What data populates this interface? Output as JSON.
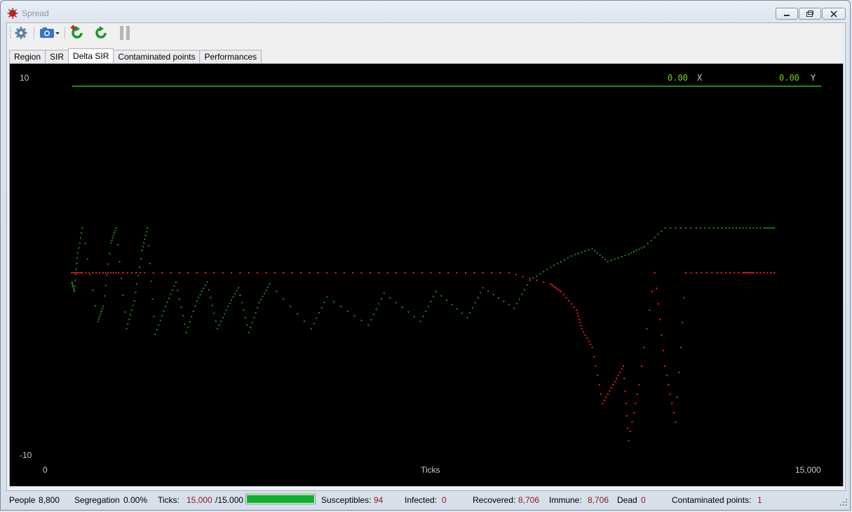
{
  "window": {
    "title": "Spread"
  },
  "toolbar": {
    "icons": [
      "gear-icon",
      "camera-icon",
      "restart-icon",
      "refresh-icon",
      "pause-icon"
    ]
  },
  "tabs": [
    {
      "label": "Region",
      "active": false
    },
    {
      "label": "SIR",
      "active": false
    },
    {
      "label": "Delta SIR",
      "active": true
    },
    {
      "label": "Contaminated points",
      "active": false
    },
    {
      "label": "Performances",
      "active": false
    }
  ],
  "plot": {
    "cursor_x_value": "0.00",
    "cursor_x_label": "X",
    "cursor_y_value": "0.00",
    "cursor_y_label": "Y",
    "colors": {
      "background": "#000000",
      "recovered": "#1f8a1f",
      "infected": "#ff1a1a",
      "readout": "#6fd400",
      "axis_text": "#c8c8c8"
    }
  },
  "chart_data": {
    "type": "scatter",
    "title": "",
    "xlabel": "Ticks",
    "ylabel": "",
    "xlim": [
      0,
      15000
    ],
    "ylim": [
      -10,
      10
    ],
    "x_tick_labels": [
      "0",
      "15,000"
    ],
    "y_tick_labels": [
      "10",
      "-10"
    ],
    "grid": false,
    "series": [
      {
        "color": "#1f8a1f",
        "description_points": "oscillating dips of green points between roughly -0.5 and -3 from ~600 to ~10,000 ticks, scattered points up to +2.4 after 10,000"
      },
      {
        "color": "#ff1a1a",
        "description_points": "red points near 0 across the run, dipping to about -9 between ~10,300 and ~11,600 ticks"
      }
    ],
    "top_line": {
      "y": 10,
      "x_start": 600,
      "x_end": 15000
    },
    "sampled_points": {
      "green": [
        [
          600,
          -0.5
        ],
        [
          650,
          -1
        ],
        [
          700,
          0.8
        ],
        [
          800,
          2.4
        ],
        [
          1100,
          -2.6
        ],
        [
          1200,
          -1.8
        ],
        [
          1350,
          1.6
        ],
        [
          1450,
          2.4
        ],
        [
          1650,
          -3.0
        ],
        [
          1800,
          -1.5
        ],
        [
          1950,
          1.2
        ],
        [
          2050,
          2.4
        ],
        [
          2200,
          -3.3
        ],
        [
          2400,
          -1.8
        ],
        [
          2600,
          -0.5
        ],
        [
          2800,
          -3.2
        ],
        [
          3000,
          -1.5
        ],
        [
          3200,
          -0.5
        ],
        [
          3400,
          -3.0
        ],
        [
          3600,
          -1.8
        ],
        [
          3800,
          -0.8
        ],
        [
          4000,
          -3.2
        ],
        [
          4200,
          -1.6
        ],
        [
          4400,
          -0.6
        ],
        [
          5200,
          -3.0
        ],
        [
          5500,
          -1.3
        ],
        [
          6300,
          -2.8
        ],
        [
          6600,
          -1.1
        ],
        [
          7300,
          -2.6
        ],
        [
          7600,
          -1.0
        ],
        [
          8200,
          -2.4
        ],
        [
          8500,
          -0.8
        ],
        [
          9100,
          -1.9
        ],
        [
          9400,
          -0.4
        ],
        [
          9800,
          0.3
        ],
        [
          10200,
          0.9
        ],
        [
          10600,
          1.3
        ],
        [
          10900,
          0.6
        ],
        [
          11300,
          1.0
        ],
        [
          11600,
          1.4
        ],
        [
          12000,
          2.4
        ],
        [
          12600,
          2.4
        ],
        [
          13100,
          2.4
        ],
        [
          13500,
          2.4
        ],
        [
          13900,
          2.4
        ],
        [
          14100,
          2.4
        ]
      ],
      "red": [
        [
          600,
          0
        ],
        [
          800,
          0
        ],
        [
          1200,
          0
        ],
        [
          1500,
          0
        ],
        [
          2000,
          0
        ],
        [
          3000,
          0
        ],
        [
          4000,
          0
        ],
        [
          5000,
          0
        ],
        [
          6000,
          0
        ],
        [
          7000,
          0
        ],
        [
          8000,
          0
        ],
        [
          9000,
          0
        ],
        [
          9800,
          -0.6
        ],
        [
          10000,
          -1
        ],
        [
          10300,
          -2
        ],
        [
          10400,
          -3
        ],
        [
          10600,
          -4
        ],
        [
          10800,
          -7
        ],
        [
          11000,
          -6
        ],
        [
          11200,
          -5
        ],
        [
          11300,
          -9
        ],
        [
          11500,
          -6
        ],
        [
          11800,
          0
        ],
        [
          12000,
          -5
        ],
        [
          12200,
          -8
        ],
        [
          12400,
          0
        ],
        [
          13000,
          0
        ],
        [
          13500,
          0
        ],
        [
          13700,
          0
        ],
        [
          14100,
          0
        ]
      ]
    }
  },
  "status": {
    "people_label": "People",
    "people_value": "8,800",
    "segregation_label": "Segregation",
    "segregation_value": "0.00%",
    "ticks_label": "Ticks:",
    "ticks_value": "15,000",
    "ticks_total": "/15.000",
    "progress": 1.0,
    "susceptibles_label": "Susceptibles:",
    "susceptibles_value": "94",
    "infected_label": "Infected:",
    "infected_value": "0",
    "recovered_label": "Recovered:",
    "recovered_value": "8,706",
    "immune_label": "Immune:",
    "immune_value": "8,706",
    "dead_label": "Dead",
    "dead_value": "0",
    "contaminated_label": "Contaminated points:",
    "contaminated_value": "1"
  }
}
